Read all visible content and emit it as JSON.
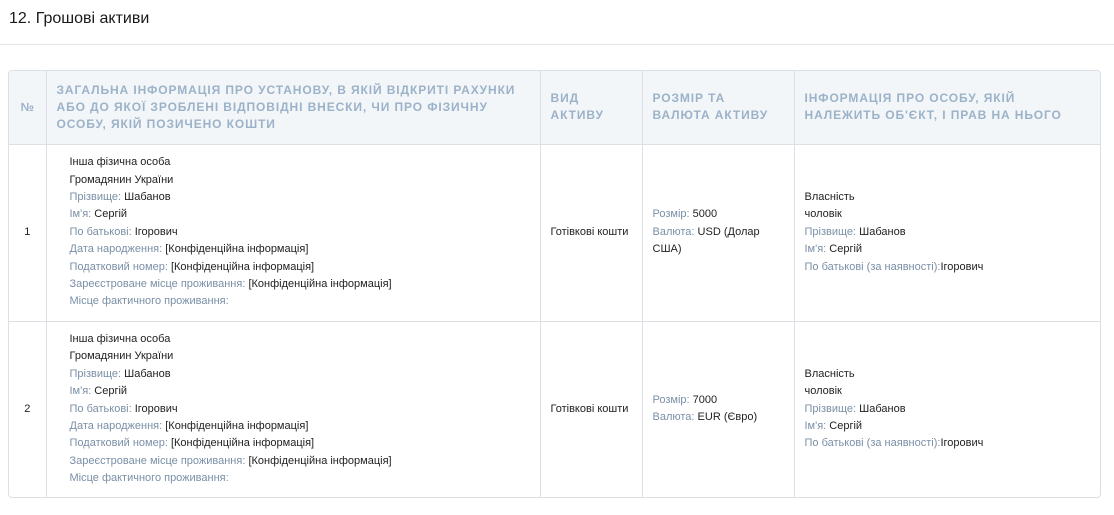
{
  "section": {
    "title": "12. Грошові активи"
  },
  "table": {
    "headers": {
      "num": "№",
      "info": "Загальна інформація про установу, в якій відкриті рахунки або до якої зроблені відповідні внески, чи про фізичну особу, якій позичено кошти",
      "asset_type": "Вид активу",
      "size_currency": "Розмір та валюта активу",
      "owner_info": "Інформація про особу, якій належить об'єкт, і прав на нього"
    },
    "rows": [
      {
        "num": "1",
        "info": {
          "line1": "Інша фізична особа",
          "line2": "Громадянин України",
          "surname_label": "Прізвище:",
          "surname": "Шабанов",
          "name_label": "Ім'я:",
          "name": "Сергій",
          "patronymic_label": "По батькові:",
          "patronymic": "Ігорович",
          "birth_label": "Дата народження:",
          "birth": "[Конфіденційна інформація]",
          "tax_label": "Податковий номер:",
          "tax": "[Конфіденційна інформація]",
          "reg_label": "Зареєстроване місце проживання:",
          "reg": "[Конфіденційна інформація]",
          "actual_label": "Місце фактичного проживання:"
        },
        "asset_type": "Готівкові кошти",
        "size": {
          "size_label": "Розмір:",
          "size": "5000",
          "currency_label": "Валюта:",
          "currency": "USD (Долар США)"
        },
        "owner": {
          "right": "Власність",
          "relation": "чоловік",
          "surname_label": "Прізвище:",
          "surname": "Шабанов",
          "name_label": "Ім'я:",
          "name": "Сергій",
          "patronymic_label": "По батькові (за наявності):",
          "patronymic": "Ігорович"
        }
      },
      {
        "num": "2",
        "info": {
          "line1": "Інша фізична особа",
          "line2": "Громадянин України",
          "surname_label": "Прізвище:",
          "surname": "Шабанов",
          "name_label": "Ім'я:",
          "name": "Сергій",
          "patronymic_label": "По батькові:",
          "patronymic": "Ігорович",
          "birth_label": "Дата народження:",
          "birth": "[Конфіденційна інформація]",
          "tax_label": "Податковий номер:",
          "tax": "[Конфіденційна інформація]",
          "reg_label": "Зареєстроване місце проживання:",
          "reg": "[Конфіденційна інформація]",
          "actual_label": "Місце фактичного проживання:"
        },
        "asset_type": "Готівкові кошти",
        "size": {
          "size_label": "Розмір:",
          "size": "7000",
          "currency_label": "Валюта:",
          "currency": "EUR (Євро)"
        },
        "owner": {
          "right": "Власність",
          "relation": "чоловік",
          "surname_label": "Прізвище:",
          "surname": "Шабанов",
          "name_label": "Ім'я:",
          "name": "Сергій",
          "patronymic_label": "По батькові (за наявності):",
          "patronymic": "Ігорович"
        }
      }
    ]
  }
}
